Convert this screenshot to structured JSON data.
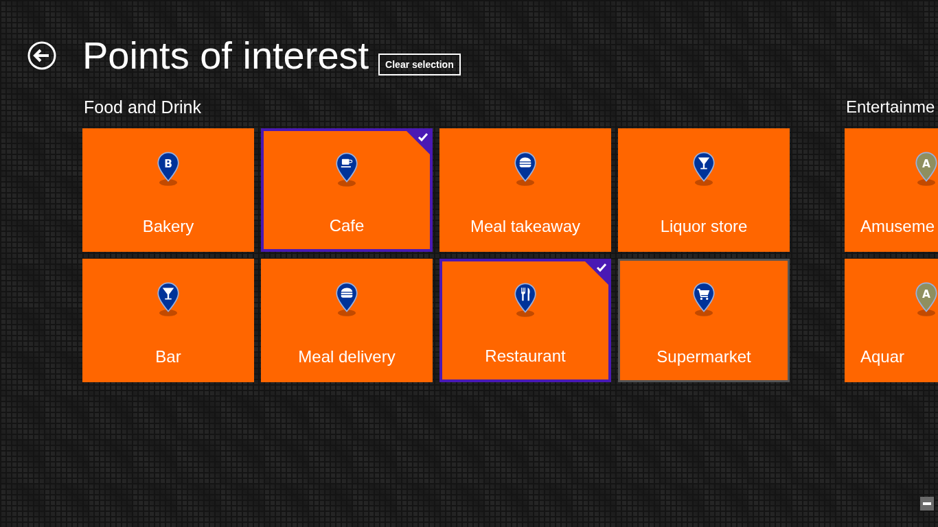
{
  "header": {
    "title": "Points of interest",
    "clear_button": "Clear selection"
  },
  "groups": [
    {
      "title": "Food and Drink",
      "tiles": [
        {
          "label": "Bakery",
          "kind": "letter",
          "pin_letter": "B",
          "color": "#003399",
          "selected": false,
          "hovered": false
        },
        {
          "label": "Cafe",
          "kind": "cup",
          "color": "#003399",
          "selected": true,
          "hovered": false
        },
        {
          "label": "Meal takeaway",
          "kind": "burger",
          "color": "#003399",
          "selected": false,
          "hovered": false
        },
        {
          "label": "Liquor store",
          "kind": "cocktail",
          "color": "#003399",
          "selected": false,
          "hovered": false
        },
        {
          "label": "Bar",
          "kind": "cocktail",
          "color": "#003399",
          "selected": false,
          "hovered": false
        },
        {
          "label": "Meal delivery",
          "kind": "burger",
          "color": "#003399",
          "selected": false,
          "hovered": false
        },
        {
          "label": "Restaurant",
          "kind": "cutlery",
          "color": "#003399",
          "selected": true,
          "hovered": false
        },
        {
          "label": "Supermarket",
          "kind": "cart",
          "color": "#003399",
          "selected": false,
          "hovered": true
        }
      ]
    },
    {
      "title": "Entertainme",
      "tiles": [
        {
          "label": "Amuseme",
          "kind": "letter",
          "pin_letter": "A",
          "color": "#8f8f5f",
          "selected": false,
          "hovered": false
        },
        {
          "label": "Aquar",
          "kind": "letter",
          "pin_letter": "A",
          "color": "#8f8f5f",
          "selected": false,
          "hovered": false
        }
      ]
    }
  ]
}
